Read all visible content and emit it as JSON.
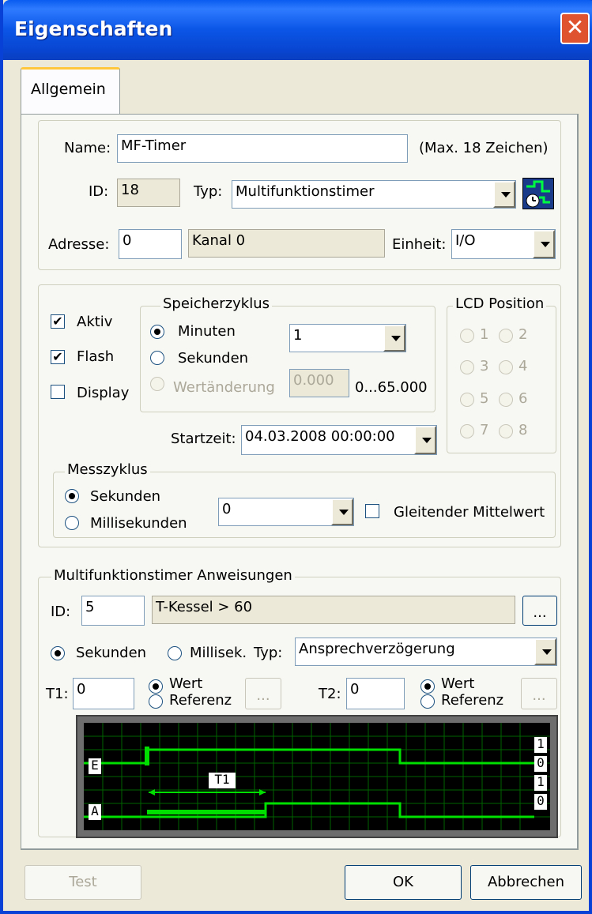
{
  "window": {
    "title": "Eigenschaften",
    "close_glyph": "✕"
  },
  "tab": {
    "label": "Allgemein"
  },
  "general": {
    "name_label": "Name:",
    "name_value": "MF-Timer",
    "name_hint": "(Max. 18 Zeichen)",
    "id_label": "ID:",
    "id_value": "18",
    "typ_label": "Typ:",
    "typ_value": "Multifunktionstimer",
    "typ_icon": "timer-module-icon",
    "adresse_label": "Adresse:",
    "adresse_value": "0",
    "kanal_value": "Kanal 0",
    "einheit_label": "Einheit:",
    "einheit_value": "I/O"
  },
  "options": {
    "aktiv": {
      "label": "Aktiv",
      "checked": true
    },
    "flash": {
      "label": "Flash",
      "checked": true
    },
    "display": {
      "label": "Display",
      "checked": false
    },
    "check_glyph": "✔"
  },
  "speicherzyklus": {
    "title": "Speicherzyklus",
    "minuten": "Minuten",
    "sekunden": "Sekunden",
    "wertaenderung": "Wertänderung",
    "selected": "Minuten",
    "cycle_value": "1",
    "change_value": "0.000",
    "range": "0...65.000"
  },
  "lcd": {
    "title": "LCD Position",
    "positions": [
      "1",
      "2",
      "3",
      "4",
      "5",
      "6",
      "7",
      "8"
    ]
  },
  "startzeit": {
    "label": "Startzeit:",
    "value": "04.03.2008 00:00:00"
  },
  "messzyklus": {
    "title": "Messzyklus",
    "sekunden": "Sekunden",
    "millisekunden": "Millisekunden",
    "selected": "Sekunden",
    "value": "0",
    "gleitender_label": "Gleitender Mittelwert",
    "gleitender_checked": false
  },
  "timer": {
    "title": "Multifunktionstimer Anweisungen",
    "id_label": "ID:",
    "id_value": "5",
    "desc_value": "T-Kessel > 60",
    "browse_label": "...",
    "sekunden": "Sekunden",
    "millisek": "Millisek.",
    "typ_label": "Typ:",
    "typ_value": "Ansprechverzögerung",
    "t1_label": "T1:",
    "t1_value": "0",
    "t2_label": "T2:",
    "t2_value": "0",
    "wert": "Wert",
    "referenz": "Referenz"
  },
  "diagram": {
    "e_label": "E",
    "a_label": "A",
    "t1_label": "T1",
    "levels": [
      "1",
      "0",
      "1",
      "0"
    ],
    "line_color": "#00E000",
    "grid_color": "#006400"
  },
  "buttons": {
    "test": "Test",
    "ok": "OK",
    "cancel": "Abbrechen"
  }
}
